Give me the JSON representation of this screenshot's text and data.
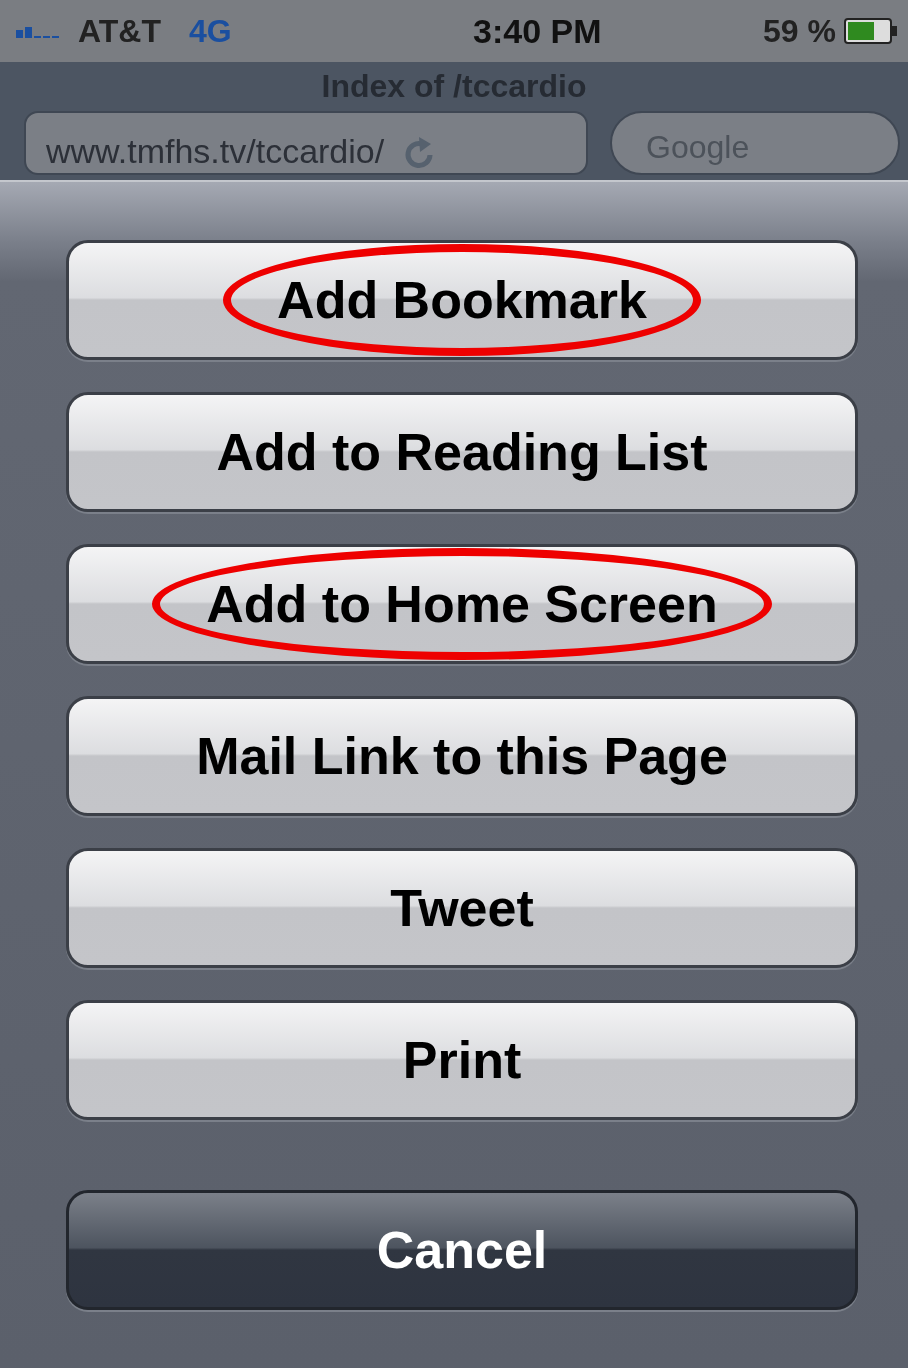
{
  "status_bar": {
    "carrier": "AT&T",
    "network": "4G",
    "time": "3:40 PM",
    "battery": "59 %"
  },
  "browser": {
    "title": "Index of /tccardio",
    "url": "www.tmfhs.tv/tccardio/",
    "search": {
      "placeholder": "Google"
    }
  },
  "action_sheet": {
    "buttons": [
      {
        "label": "Add Bookmark",
        "kind": "action",
        "circled": true
      },
      {
        "label": "Add to Reading List",
        "kind": "action",
        "circled": false
      },
      {
        "label": "Add to Home Screen",
        "kind": "action",
        "circled": true
      },
      {
        "label": "Mail Link to this Page",
        "kind": "action",
        "circled": false
      },
      {
        "label": "Tweet",
        "kind": "action",
        "circled": false
      },
      {
        "label": "Print",
        "kind": "action",
        "circled": false
      },
      {
        "label": "Cancel",
        "kind": "cancel",
        "circled": false
      }
    ]
  }
}
